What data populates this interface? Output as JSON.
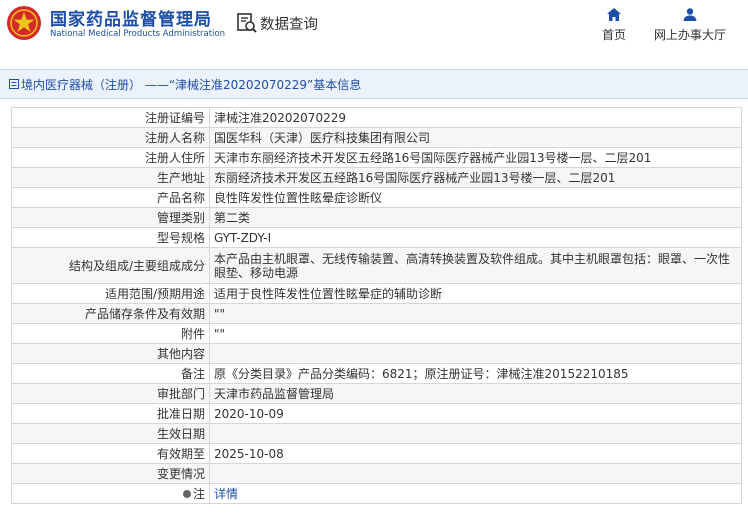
{
  "header": {
    "agency_name": "国家药品监督管理局",
    "agency_name_en": "National Medical Products Administration",
    "query_label": "数据查询",
    "nav": [
      {
        "icon": "home-icon",
        "label": "首页"
      },
      {
        "icon": "user-icon",
        "label": "网上办事大厅"
      }
    ]
  },
  "breadcrumb": "境内医疗器械（注册） ——“津械注准20202070229”基本信息",
  "colors": {
    "brand_blue": "#1e4fa8",
    "logo_red": "#d32a2a",
    "logo_gold": "#f0c419"
  },
  "details": [
    {
      "label": "注册证编号",
      "value": "津械注准20202070229"
    },
    {
      "label": "注册人名称",
      "value": "国医华科（天津）医疗科技集团有限公司"
    },
    {
      "label": "注册人住所",
      "value": "天津市东丽经济技术开发区五经路16号国际医疗器械产业园13号楼一层、二层201"
    },
    {
      "label": "生产地址",
      "value": "东丽经济技术开发区五经路16号国际医疗器械产业园13号楼一层、二层201"
    },
    {
      "label": "产品名称",
      "value": "良性阵发性位置性眩晕症诊断仪"
    },
    {
      "label": "管理类别",
      "value": "第二类"
    },
    {
      "label": "型号规格",
      "value": "GYT-ZDY-I"
    },
    {
      "label": "结构及组成/主要组成成分",
      "value": "本产品由主机眼罩、无线传输装置、高清转换装置及软件组成。其中主机眼罩包括：眼罩、一次性眼垫、移动电源"
    },
    {
      "label": "适用范围/预期用途",
      "value": "适用于良性阵发性位置性眩晕症的辅助诊断"
    },
    {
      "label": "产品储存条件及有效期",
      "value": "\"\""
    },
    {
      "label": "附件",
      "value": "\"\""
    },
    {
      "label": "其他内容",
      "value": ""
    },
    {
      "label": "备注",
      "value": "原《分类目录》产品分类编码：6821；原注册证号：津械注准20152210185"
    },
    {
      "label": "审批部门",
      "value": "天津市药品监督管理局"
    },
    {
      "label": "批准日期",
      "value": "2020-10-09"
    },
    {
      "label": "生效日期",
      "value": ""
    },
    {
      "label": "有效期至",
      "value": "2025-10-08"
    },
    {
      "label": "变更情况",
      "value": ""
    }
  ],
  "note": {
    "label": "注",
    "link": "详情"
  }
}
